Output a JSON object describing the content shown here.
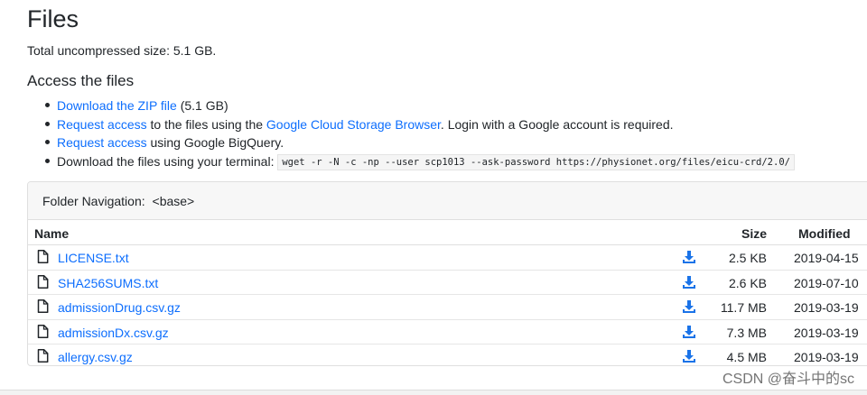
{
  "header": {
    "title": "Files",
    "total_size": "Total uncompressed size: 5.1 GB."
  },
  "access": {
    "heading": "Access the files",
    "items": [
      {
        "link": "Download the ZIP file",
        "text": " (5.1 GB)"
      },
      {
        "link": "Request access",
        "text": " to the files using the ",
        "link2": "Google Cloud Storage Browser",
        "text2": ". Login with a Google account is required."
      },
      {
        "link": "Request access",
        "text": " using Google BigQuery."
      },
      {
        "text": "Download the files using your terminal: ",
        "command": "wget -r -N -c -np --user scp1013 --ask-password https://physionet.org/files/eicu-crd/2.0/"
      }
    ]
  },
  "folder_nav": {
    "label": "Folder Navigation:",
    "path": "<base>"
  },
  "table": {
    "columns": {
      "name": "Name",
      "size": "Size",
      "modified": "Modified"
    },
    "rows": [
      {
        "name": "LICENSE.txt",
        "size": "2.5 KB",
        "modified": "2019-04-15"
      },
      {
        "name": "SHA256SUMS.txt",
        "size": "2.6 KB",
        "modified": "2019-07-10"
      },
      {
        "name": "admissionDrug.csv.gz",
        "size": "11.7 MB",
        "modified": "2019-03-19"
      },
      {
        "name": "admissionDx.csv.gz",
        "size": "7.3 MB",
        "modified": "2019-03-19"
      },
      {
        "name": "allergy.csv.gz",
        "size": "4.5 MB",
        "modified": "2019-03-19"
      }
    ]
  },
  "watermark": "CSDN @奋斗中的sc",
  "colors": {
    "link": "#0d6efd",
    "text": "#212529",
    "header_bg": "#f7f7f7"
  },
  "icons": {
    "file": "file-icon",
    "download": "download-icon"
  }
}
